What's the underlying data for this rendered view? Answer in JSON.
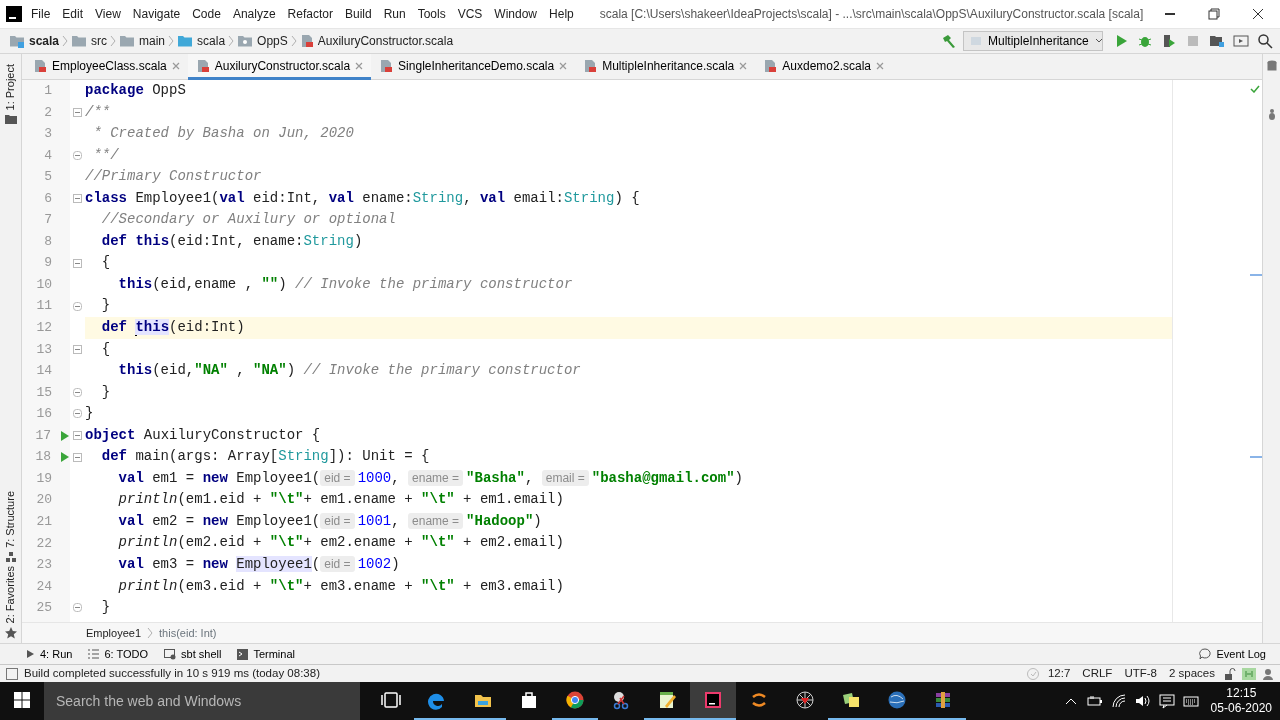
{
  "menu": [
    "File",
    "Edit",
    "View",
    "Navigate",
    "Code",
    "Analyze",
    "Refactor",
    "Build",
    "Run",
    "Tools",
    "VCS",
    "Window",
    "Help"
  ],
  "window": {
    "title": "scala [C:\\Users\\shakeer\\IdeaProjects\\scala] - ...\\src\\main\\scala\\OppS\\AuxiluryConstructor.scala [scala]"
  },
  "breadcrumbs": [
    {
      "label": "scala",
      "kind": "module"
    },
    {
      "label": "src",
      "kind": "folder"
    },
    {
      "label": "main",
      "kind": "folder"
    },
    {
      "label": "scala",
      "kind": "source"
    },
    {
      "label": "OppS",
      "kind": "package"
    },
    {
      "label": "AuxiluryConstructor.scala",
      "kind": "file"
    }
  ],
  "run_config": {
    "label": "MultipleInheritance"
  },
  "tabs": [
    {
      "label": "EmployeeClass.scala",
      "selected": false
    },
    {
      "label": "AuxiluryConstructor.scala",
      "selected": true
    },
    {
      "label": "SingleInheritanceDemo.scala",
      "selected": false
    },
    {
      "label": "MultipleInheritance.scala",
      "selected": false
    },
    {
      "label": "Auxdemo2.scala",
      "selected": false
    }
  ],
  "left_tools_top": [
    {
      "label": "1: Project"
    }
  ],
  "left_tools_bottom": [
    {
      "label": "7: Structure"
    },
    {
      "label": "2: Favorites"
    }
  ],
  "code_lines": [
    {
      "number": "1",
      "run": false,
      "current": false,
      "fold_start": false,
      "fold_end": false,
      "tokens": [
        {
          "kind": "kw",
          "text": "package"
        },
        {
          "kind": "plain",
          "text": " OppS"
        }
      ]
    },
    {
      "number": "2",
      "run": false,
      "current": false,
      "fold_start": true,
      "fold_end": false,
      "tokens": [
        {
          "kind": "doc",
          "text": "/**"
        }
      ]
    },
    {
      "number": "3",
      "run": false,
      "current": false,
      "fold_start": false,
      "fold_end": false,
      "tokens": [
        {
          "kind": "doc",
          "text": " * Created by Basha on Jun, 2020"
        }
      ]
    },
    {
      "number": "4",
      "run": false,
      "current": false,
      "fold_start": false,
      "fold_end": true,
      "tokens": [
        {
          "kind": "doc",
          "text": " **/"
        }
      ]
    },
    {
      "number": "5",
      "run": false,
      "current": false,
      "fold_start": false,
      "fold_end": false,
      "tokens": [
        {
          "kind": "comment",
          "text": "//Primary Constructor"
        }
      ]
    },
    {
      "number": "6",
      "run": false,
      "current": false,
      "fold_start": true,
      "fold_end": false,
      "tokens": [
        {
          "kind": "kw",
          "text": "class"
        },
        {
          "kind": "plain",
          "text": " Employee1("
        },
        {
          "kind": "kw",
          "text": "val"
        },
        {
          "kind": "plain",
          "text": " eid:Int, "
        },
        {
          "kind": "kw",
          "text": "val"
        },
        {
          "kind": "plain",
          "text": " ename:"
        },
        {
          "kind": "type",
          "text": "String"
        },
        {
          "kind": "plain",
          "text": ", "
        },
        {
          "kind": "kw",
          "text": "val"
        },
        {
          "kind": "plain",
          "text": " email:"
        },
        {
          "kind": "type",
          "text": "String"
        },
        {
          "kind": "plain",
          "text": ") {"
        }
      ]
    },
    {
      "number": "7",
      "run": false,
      "current": false,
      "fold_start": false,
      "fold_end": false,
      "tokens": [
        {
          "kind": "comment",
          "text": "  //Secondary or Auxilury or optional"
        }
      ]
    },
    {
      "number": "8",
      "run": false,
      "current": false,
      "fold_start": false,
      "fold_end": false,
      "tokens": [
        {
          "kind": "kw",
          "text": "  def "
        },
        {
          "kind": "kw",
          "text": "this"
        },
        {
          "kind": "plain",
          "text": "(eid:Int, ename:"
        },
        {
          "kind": "type",
          "text": "String"
        },
        {
          "kind": "plain",
          "text": ")"
        }
      ]
    },
    {
      "number": "9",
      "run": false,
      "current": false,
      "fold_start": true,
      "fold_end": false,
      "tokens": [
        {
          "kind": "plain",
          "text": "  {"
        }
      ]
    },
    {
      "number": "10",
      "run": false,
      "current": false,
      "fold_start": false,
      "fold_end": false,
      "tokens": [
        {
          "kind": "kw",
          "text": "    this"
        },
        {
          "kind": "plain",
          "text": "(eid,ename , "
        },
        {
          "kind": "str",
          "text": "\"\""
        },
        {
          "kind": "plain",
          "text": ") "
        },
        {
          "kind": "comment",
          "text": "// Invoke the primary constructor"
        }
      ]
    },
    {
      "number": "11",
      "run": false,
      "current": false,
      "fold_start": false,
      "fold_end": true,
      "tokens": [
        {
          "kind": "plain",
          "text": "  }"
        }
      ]
    },
    {
      "number": "12",
      "run": false,
      "current": true,
      "fold_start": false,
      "fold_end": false,
      "tokens": [
        {
          "kind": "kw",
          "text": "  def "
        },
        {
          "kind": "kw_hl",
          "text": "this"
        },
        {
          "kind": "plain",
          "text": "(eid:Int)"
        }
      ]
    },
    {
      "number": "13",
      "run": false,
      "current": false,
      "fold_start": true,
      "fold_end": false,
      "tokens": [
        {
          "kind": "plain",
          "text": "  {"
        }
      ]
    },
    {
      "number": "14",
      "run": false,
      "current": false,
      "fold_start": false,
      "fold_end": false,
      "tokens": [
        {
          "kind": "kw",
          "text": "    this"
        },
        {
          "kind": "plain",
          "text": "(eid,"
        },
        {
          "kind": "str",
          "text": "\"NA\""
        },
        {
          "kind": "plain",
          "text": " , "
        },
        {
          "kind": "str",
          "text": "\"NA\""
        },
        {
          "kind": "plain",
          "text": ") "
        },
        {
          "kind": "comment",
          "text": "// Invoke the primary constructor"
        }
      ]
    },
    {
      "number": "15",
      "run": false,
      "current": false,
      "fold_start": false,
      "fold_end": true,
      "tokens": [
        {
          "kind": "plain",
          "text": "  }"
        }
      ]
    },
    {
      "number": "16",
      "run": false,
      "current": false,
      "fold_start": false,
      "fold_end": true,
      "tokens": [
        {
          "kind": "plain",
          "text": "}"
        }
      ]
    },
    {
      "number": "17",
      "run": true,
      "current": false,
      "fold_start": true,
      "fold_end": false,
      "tokens": [
        {
          "kind": "kw",
          "text": "object"
        },
        {
          "kind": "plain",
          "text": " AuxiluryConstructor {"
        }
      ]
    },
    {
      "number": "18",
      "run": true,
      "current": false,
      "fold_start": true,
      "fold_end": false,
      "tokens": [
        {
          "kind": "kw",
          "text": "  def"
        },
        {
          "kind": "plain",
          "text": " main(args: Array["
        },
        {
          "kind": "type",
          "text": "String"
        },
        {
          "kind": "plain",
          "text": "]): Unit = {"
        }
      ]
    },
    {
      "number": "19",
      "run": false,
      "current": false,
      "fold_start": false,
      "fold_end": false,
      "tokens": [
        {
          "kind": "kw",
          "text": "    val"
        },
        {
          "kind": "plain",
          "text": " em1 = "
        },
        {
          "kind": "kw",
          "text": "new"
        },
        {
          "kind": "plain",
          "text": " Employee1("
        },
        {
          "kind": "hint",
          "text": "eid ="
        },
        {
          "kind": "num",
          "text": "1000"
        },
        {
          "kind": "plain",
          "text": ", "
        },
        {
          "kind": "hint",
          "text": "ename ="
        },
        {
          "kind": "str",
          "text": "\"Basha\""
        },
        {
          "kind": "plain",
          "text": ", "
        },
        {
          "kind": "hint",
          "text": "email ="
        },
        {
          "kind": "str",
          "text": "\"basha@gmail.com\""
        },
        {
          "kind": "plain",
          "text": ")"
        }
      ]
    },
    {
      "number": "20",
      "run": false,
      "current": false,
      "fold_start": false,
      "fold_end": false,
      "tokens": [
        {
          "kind": "fn",
          "text": "    println"
        },
        {
          "kind": "plain",
          "text": "(em1.eid + "
        },
        {
          "kind": "str",
          "text": "\"\\t\""
        },
        {
          "kind": "plain",
          "text": "+ em1.ename + "
        },
        {
          "kind": "str",
          "text": "\"\\t\""
        },
        {
          "kind": "plain",
          "text": " + em1.email)"
        }
      ]
    },
    {
      "number": "21",
      "run": false,
      "current": false,
      "fold_start": false,
      "fold_end": false,
      "tokens": [
        {
          "kind": "kw",
          "text": "    val"
        },
        {
          "kind": "plain",
          "text": " em2 = "
        },
        {
          "kind": "kw",
          "text": "new"
        },
        {
          "kind": "plain",
          "text": " Employee1("
        },
        {
          "kind": "hint",
          "text": "eid ="
        },
        {
          "kind": "num",
          "text": "1001"
        },
        {
          "kind": "plain",
          "text": ", "
        },
        {
          "kind": "hint",
          "text": "ename ="
        },
        {
          "kind": "str",
          "text": "\"Hadoop\""
        },
        {
          "kind": "plain",
          "text": ")"
        }
      ]
    },
    {
      "number": "22",
      "run": false,
      "current": false,
      "fold_start": false,
      "fold_end": false,
      "tokens": [
        {
          "kind": "fn",
          "text": "    println"
        },
        {
          "kind": "plain",
          "text": "(em2.eid + "
        },
        {
          "kind": "str",
          "text": "\"\\t\""
        },
        {
          "kind": "plain",
          "text": "+ em2.ename + "
        },
        {
          "kind": "str",
          "text": "\"\\t\""
        },
        {
          "kind": "plain",
          "text": " + em2.email)"
        }
      ]
    },
    {
      "number": "23",
      "run": false,
      "current": false,
      "fold_start": false,
      "fold_end": false,
      "tokens": [
        {
          "kind": "kw",
          "text": "    val"
        },
        {
          "kind": "plain",
          "text": " em3 = "
        },
        {
          "kind": "kw",
          "text": "new "
        },
        {
          "kind": "ref_hl",
          "text": "Employee1"
        },
        {
          "kind": "plain",
          "text": "("
        },
        {
          "kind": "hint",
          "text": "eid ="
        },
        {
          "kind": "num",
          "text": "1002"
        },
        {
          "kind": "plain",
          "text": ")"
        }
      ]
    },
    {
      "number": "24",
      "run": false,
      "current": false,
      "fold_start": false,
      "fold_end": false,
      "tokens": [
        {
          "kind": "fn",
          "text": "    println"
        },
        {
          "kind": "plain",
          "text": "(em3.eid + "
        },
        {
          "kind": "str",
          "text": "\"\\t\""
        },
        {
          "kind": "plain",
          "text": "+ em3.ename + "
        },
        {
          "kind": "str",
          "text": "\"\\t\""
        },
        {
          "kind": "plain",
          "text": " + em3.email)"
        }
      ]
    },
    {
      "number": "25",
      "run": false,
      "current": false,
      "fold_start": false,
      "fold_end": true,
      "tokens": [
        {
          "kind": "plain",
          "text": "  }"
        }
      ]
    }
  ],
  "code_path": [
    "Employee1",
    "this(eid: Int)"
  ],
  "tool_windows": [
    {
      "label": "4: Run",
      "kind": "run"
    },
    {
      "label": "6: TODO",
      "kind": "todo"
    },
    {
      "label": "sbt shell",
      "kind": "sbt"
    },
    {
      "label": "Terminal",
      "kind": "terminal"
    }
  ],
  "event_log": "Event Log",
  "status": {
    "message": "Build completed successfully in 10 s 919 ms (today 08:38)",
    "position": "12:7",
    "line_separator": "CRLF",
    "encoding": "UTF-8",
    "indent": "2 spaces"
  },
  "taskbar": {
    "search_placeholder": "Search the web and Windows",
    "apps": [
      {
        "kind": "task-view",
        "running": false,
        "active": false
      },
      {
        "kind": "edge",
        "running": true,
        "active": false
      },
      {
        "kind": "explorer",
        "running": true,
        "active": false
      },
      {
        "kind": "store",
        "running": false,
        "active": false
      },
      {
        "kind": "chrome",
        "running": true,
        "active": false
      },
      {
        "kind": "snip",
        "running": false,
        "active": false
      },
      {
        "kind": "notepad",
        "running": true,
        "active": false
      },
      {
        "kind": "intellij",
        "running": true,
        "active": true
      },
      {
        "kind": "sublime",
        "running": false,
        "active": false
      },
      {
        "kind": "spider",
        "running": false,
        "active": false
      },
      {
        "kind": "sticky",
        "running": true,
        "active": false
      },
      {
        "kind": "globe",
        "running": true,
        "active": false
      },
      {
        "kind": "winrar",
        "running": true,
        "active": false
      }
    ],
    "time": "12:15",
    "date": "05-06-2020"
  }
}
